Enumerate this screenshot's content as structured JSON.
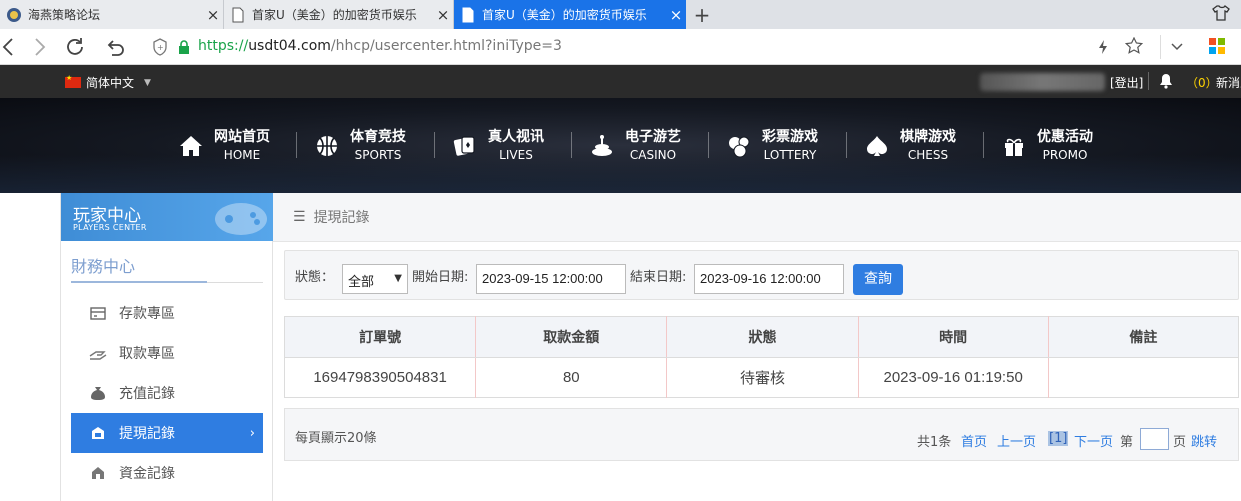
{
  "browser": {
    "tabs": [
      {
        "title": "海燕策略论坛",
        "close": "×"
      },
      {
        "title": "首家U（美金）的加密货币娱乐",
        "close": "×"
      },
      {
        "title": "首家U（美金）的加密货币娱乐",
        "close": "×"
      }
    ],
    "new_tab": "+",
    "url_protocol": "https://",
    "url_host": "usdt04.com",
    "url_path": "/hhcp/usercenter.html?iniType=3"
  },
  "topbar": {
    "language": "简体中文",
    "logout": "[登出]",
    "message_count": "（0）",
    "message_label": "新消息"
  },
  "nav": [
    {
      "cn": "网站首页",
      "en": "HOME",
      "icon": "home-icon"
    },
    {
      "cn": "体育竞技",
      "en": "SPORTS",
      "icon": "basketball-icon"
    },
    {
      "cn": "真人视讯",
      "en": "LIVES",
      "icon": "cards-icon"
    },
    {
      "cn": "电子游艺",
      "en": "CASINO",
      "icon": "slot-icon"
    },
    {
      "cn": "彩票游戏",
      "en": "LOTTERY",
      "icon": "lottery-balls-icon"
    },
    {
      "cn": "棋牌游戏",
      "en": "CHESS",
      "icon": "spade-icon"
    },
    {
      "cn": "优惠活动",
      "en": "PROMO",
      "icon": "gift-icon"
    }
  ],
  "sidebar": {
    "header_cn": "玩家中心",
    "header_en": "PLAYERS CENTER",
    "section": "財務中心",
    "items": [
      {
        "label": "存款專區",
        "icon": "deposit-icon"
      },
      {
        "label": "取款專區",
        "icon": "withdraw-icon"
      },
      {
        "label": "充值記錄",
        "icon": "moneybag-icon"
      },
      {
        "label": "提現記錄",
        "icon": "cash-out-icon",
        "active": true,
        "chevron": "›"
      },
      {
        "label": "資金記錄",
        "icon": "fund-record-icon"
      }
    ]
  },
  "breadcrumb": "提現記錄",
  "filter": {
    "status_label": "狀態：",
    "status_value": "全部",
    "start_label": "開始日期:",
    "start_value": "2023-09-15 12:00:00",
    "end_label": "結束日期:",
    "end_value": "2023-09-16 12:00:00",
    "query_button": "查詢"
  },
  "table": {
    "headers": [
      "訂單號",
      "取款金額",
      "狀態",
      "時間",
      "備註"
    ],
    "rows": [
      [
        "1694798390504831",
        "80",
        "待審核",
        "2023-09-16 01:19:50",
        ""
      ]
    ]
  },
  "pager": {
    "per_page": "每頁顯示20條",
    "total": "共1条",
    "first": "首页",
    "prev": "上一页",
    "current": "[1]",
    "next": "下一页",
    "page_prefix": "第",
    "page_suffix": "页",
    "go": "跳转"
  },
  "colors": {
    "accent": "#2f7de1",
    "topbar": "#2b2b2b",
    "tab_active": "#1a73e8"
  }
}
